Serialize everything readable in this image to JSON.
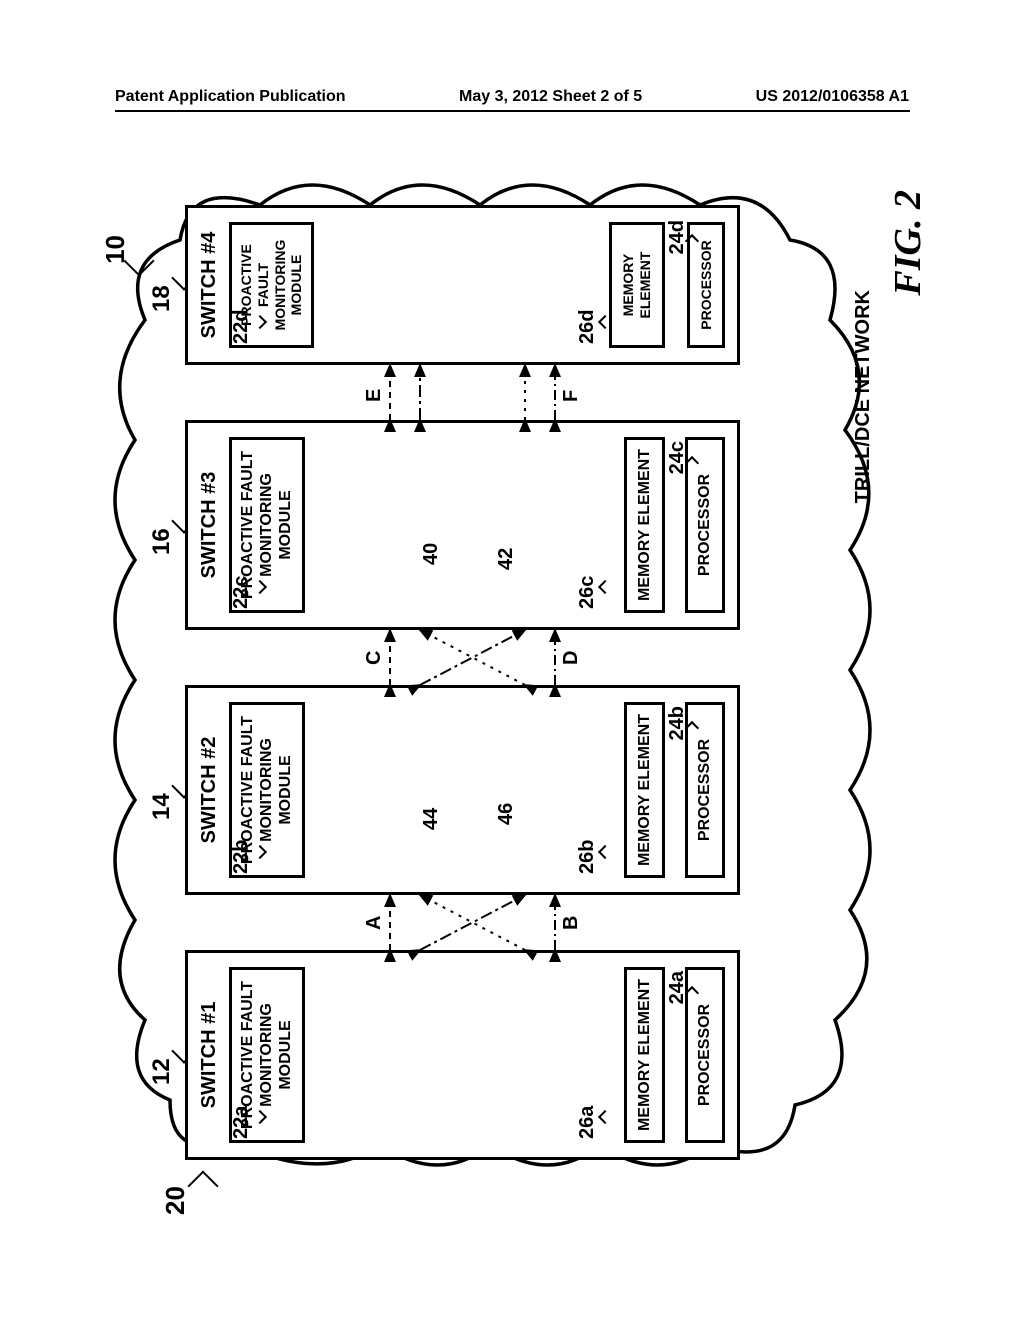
{
  "header": {
    "left": "Patent Application Publication",
    "center": "May 3, 2012  Sheet 2 of 5",
    "right": "US 2012/0106358 A1"
  },
  "figure": {
    "label": "FIG. 2",
    "network_label": "TRILL/DCE NETWORK",
    "ref_main": "10",
    "ref_cloud": "20"
  },
  "switches": [
    {
      "title": "SWITCH #1",
      "top_ref": "12",
      "module": "PROACTIVE FAULT MONITORING MODULE",
      "module_ref": "22a",
      "memory": "MEMORY ELEMENT",
      "memory_ref": "26a",
      "processor": "PROCESSOR",
      "processor_ref": "24a"
    },
    {
      "title": "SWITCH #2",
      "top_ref": "14",
      "module": "PROACTIVE FAULT MONITORING MODULE",
      "module_ref": "22b",
      "memory": "MEMORY ELEMENT",
      "memory_ref": "26b",
      "processor": "PROCESSOR",
      "processor_ref": "24b"
    },
    {
      "title": "SWITCH #3",
      "top_ref": "16",
      "module": "PROACTIVE FAULT MONITORING MODULE",
      "module_ref": "22c",
      "memory": "MEMORY ELEMENT",
      "memory_ref": "26c",
      "processor": "PROCESSOR",
      "processor_ref": "24c"
    },
    {
      "title": "SWITCH #4",
      "top_ref": "18",
      "module": "PROACTIVE FAULT MONITORING MODULE",
      "module_ref": "22d",
      "memory": "MEMORY ELEMENT",
      "memory_ref": "26d",
      "processor": "PROCESSOR",
      "processor_ref": "24d"
    }
  ],
  "ports": {
    "A": "A",
    "B": "B",
    "C": "C",
    "D": "D",
    "E": "E",
    "F": "F"
  },
  "link_refs": {
    "r40": "40",
    "r42": "42",
    "r44": "44",
    "r46": "46"
  }
}
